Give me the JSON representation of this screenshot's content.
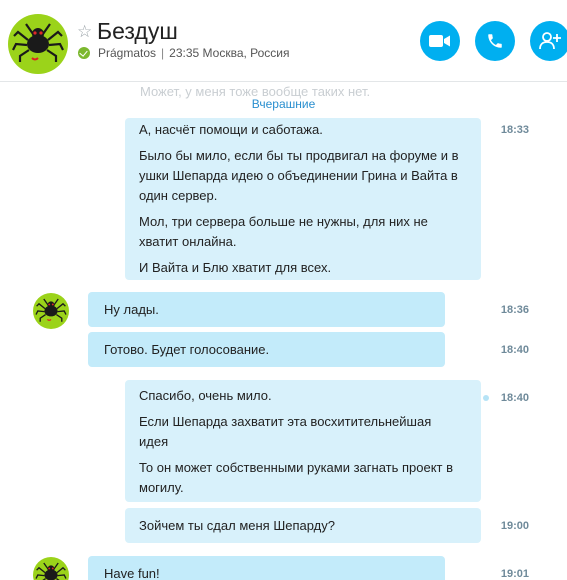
{
  "header": {
    "title": "Бездуш",
    "status_name": "Prágmatos",
    "status_sep": "|",
    "status_time": "23:35 Москва, Россия"
  },
  "chat": {
    "faded_text": "Может, у меня тоже вообще таких нет.",
    "day_divider": "Вчерашние",
    "messages": [
      {
        "direction": "out",
        "lines": [
          "А, насчёт помощи и саботажа.",
          "Было бы мило, если бы ты продвигал на форуме и в ушки Шепарда идею о объединении Грина и Вайта в один сервер.",
          "Мол, три сервера больше не нужны, для них не хватит онлайна.",
          "И Вайта и Блю хватит для всех."
        ],
        "time": "18:33"
      },
      {
        "direction": "in",
        "text": "Ну лады.",
        "time": "18:36"
      },
      {
        "direction": "in",
        "text": "Готово. Будет голосование.",
        "time": "18:40"
      },
      {
        "direction": "out",
        "lines": [
          "Спасибо, очень мило.",
          "Если Шепарда захватит эта восхитительнейшая идея",
          "То он может собственными руками загнать проект в могилу."
        ],
        "time": "18:40"
      },
      {
        "direction": "out",
        "text": "Зойчем ты сдал меня Шепарду?",
        "time": "19:00"
      },
      {
        "direction": "in",
        "text": "Have fun!",
        "time": "19:01"
      }
    ]
  },
  "icons": {
    "favorite": "star-icon",
    "video_call": "video-camera-icon",
    "audio_call": "phone-icon",
    "add_people": "add-person-icon",
    "avatar": "spider-avatar-icon"
  },
  "colors": {
    "accent": "#00aff0",
    "incoming_bubble": "#c3ebfa",
    "outgoing_bubble": "#d8f1fb",
    "online": "#7cb82f",
    "avatar_bg": "#9bd31a"
  }
}
